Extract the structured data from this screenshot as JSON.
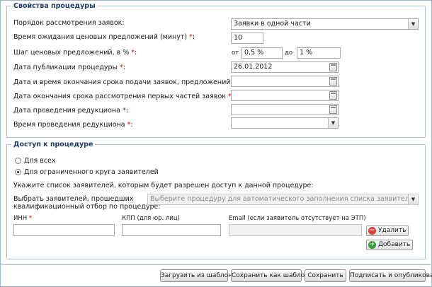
{
  "procedure_props": {
    "legend": "Свойства процедуры",
    "review_order_label": "Порядок рассмотрения заявок:",
    "review_order_value": "Заявки в одной части",
    "wait_time_label": "Время ожидания ценовых предложений (минут)",
    "wait_time_value": "10",
    "price_step_label": "Шаг ценовых предложений, в %",
    "price_step_from_label": "от",
    "price_step_from_value": "0,5 %",
    "price_step_to_label": "до",
    "price_step_to_value": "1 %",
    "publish_date_label": "Дата публикации процедуры",
    "publish_date_value": "26.01.2012",
    "end_submit_label": "Дата и время окончания срока подачи заявок, предложений",
    "end_review_label": "Дата окончания срока рассмотрения первых частей заявок",
    "reduction_date_label": "Дата проведения редукциона",
    "reduction_time_label": "Время проведения редукциона",
    "required_mark": "*"
  },
  "access": {
    "legend": "Доступ к процедуре",
    "option_all": "Для всех",
    "option_limited": "Для ограниченного круга заявителей",
    "instruction": "Укажите список заявителей, которым будет разрешен доступ к данной процедуре:",
    "select_label_line1": "Выбрать заявителей, прошедших",
    "select_label_line2": "квалификационный отбор по процедуре:",
    "select_placeholder": "Выберите процедуру для автоматического заполнения списка заявителей",
    "inn_label": "ИНН",
    "kpp_label": "КПП (для юр. лиц)",
    "email_label": "Email (если заявитель отсутствует на ЭТП)",
    "delete_button": "Удалить",
    "add_button": "Добавить"
  },
  "footer": {
    "load_template": "Загрузить из шаблона",
    "save_template": "Сохранить как шаблон",
    "save": "Сохранить",
    "sign_publish": "Подписать и опубликовать"
  },
  "icons": {
    "calendar": "calendar-icon",
    "dropdown": "chevron-down-icon",
    "delete": "minus-circle-icon",
    "add": "plus-circle-icon"
  },
  "colors": {
    "legend_text": "#1f3d6b",
    "required": "#d00000",
    "delete_icon": "#d9403a",
    "add_icon": "#3b9a3b",
    "border": "#9fb4cf"
  }
}
